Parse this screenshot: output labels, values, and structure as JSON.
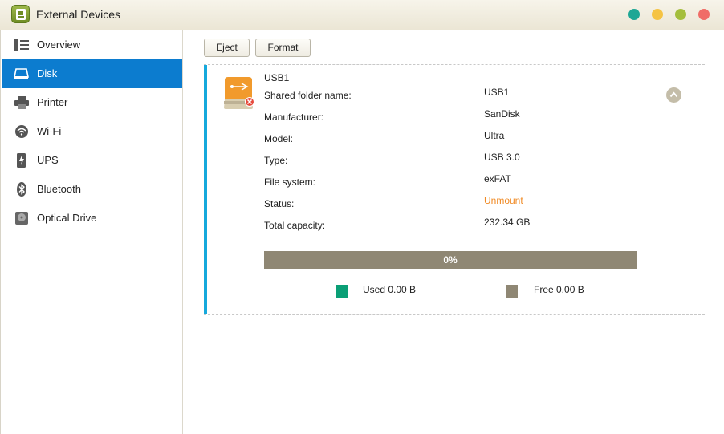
{
  "window": {
    "title": "External Devices",
    "controls": [
      "teal",
      "yellow",
      "olive",
      "red"
    ]
  },
  "sidebar": {
    "items": [
      {
        "label": "Overview",
        "icon": "overview-icon",
        "active": false
      },
      {
        "label": "Disk",
        "icon": "disk-icon",
        "active": true
      },
      {
        "label": "Printer",
        "icon": "printer-icon",
        "active": false
      },
      {
        "label": "Wi-Fi",
        "icon": "wifi-icon",
        "active": false
      },
      {
        "label": "UPS",
        "icon": "ups-icon",
        "active": false
      },
      {
        "label": "Bluetooth",
        "icon": "bluetooth-icon",
        "active": false
      },
      {
        "label": "Optical Drive",
        "icon": "optical-drive-icon",
        "active": false
      }
    ],
    "active_color": "#0c7ccf"
  },
  "toolbar": {
    "eject_label": "Eject",
    "format_label": "Format"
  },
  "device": {
    "name": "USB1",
    "icon": "usb-drive-icon",
    "details": [
      {
        "label": "Shared folder name:",
        "value": "USB1"
      },
      {
        "label": "Manufacturer:",
        "value": "SanDisk"
      },
      {
        "label": "Model:",
        "value": "Ultra"
      },
      {
        "label": "Type:",
        "value": "USB 3.0"
      },
      {
        "label": "File system:",
        "value": "exFAT"
      },
      {
        "label": "Status:",
        "value": "Unmount"
      },
      {
        "label": "Total capacity:",
        "value": "232.34 GB"
      }
    ],
    "status_color": "#f08a24",
    "usage": {
      "percent_text": "0%",
      "used_fraction": 0,
      "used_label": "Used 0.00 B",
      "free_label": "Free 0.00 B",
      "used_color": "#0a9f76",
      "free_color": "#8f8774"
    }
  }
}
